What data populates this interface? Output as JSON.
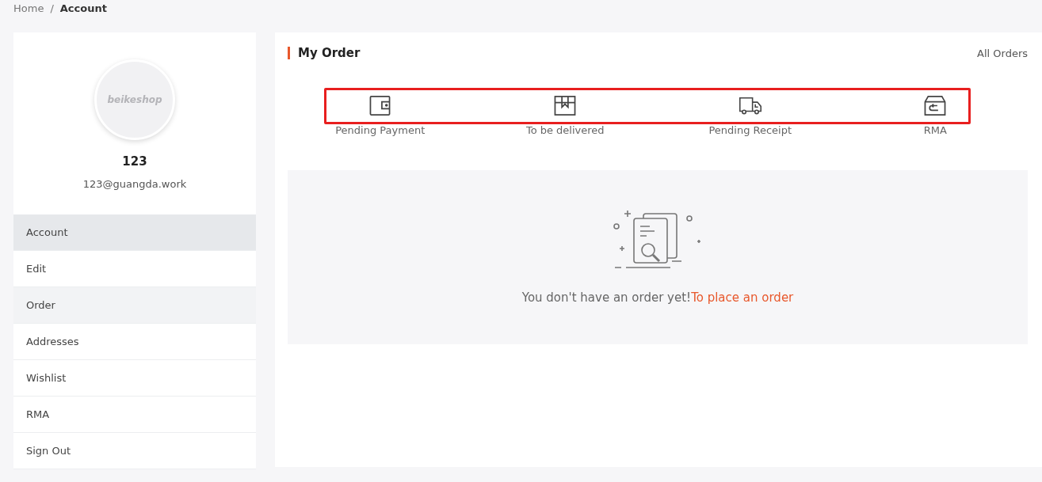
{
  "breadcrumb": [
    {
      "label": "Home",
      "current": false
    },
    {
      "separator": "/",
      "label": "Account",
      "current": true
    }
  ],
  "profile": {
    "avatar_text": "beikeshop",
    "name": "123",
    "email": "123@guangda.work"
  },
  "sidebar": {
    "items": [
      {
        "label": "Account",
        "selected": true,
        "highlighted": false
      },
      {
        "label": "Edit",
        "selected": false,
        "highlighted": false
      },
      {
        "label": "Order",
        "selected": false,
        "highlighted": true
      },
      {
        "label": "Addresses",
        "selected": false,
        "highlighted": false
      },
      {
        "label": "Wishlist",
        "selected": false,
        "highlighted": false
      },
      {
        "label": "RMA",
        "selected": false,
        "highlighted": false
      },
      {
        "label": "Sign Out",
        "selected": false,
        "highlighted": false
      }
    ]
  },
  "orders": {
    "title": "My Order",
    "all_link": "All Orders",
    "statuses": [
      {
        "kind": "wallet",
        "label": "Pending Payment"
      },
      {
        "kind": "box",
        "label": "To be delivered"
      },
      {
        "kind": "truck",
        "label": "Pending Receipt"
      },
      {
        "kind": "return",
        "label": "RMA"
      }
    ],
    "empty": {
      "message": "You don't have an order yet!",
      "link": "To place an order"
    }
  }
}
